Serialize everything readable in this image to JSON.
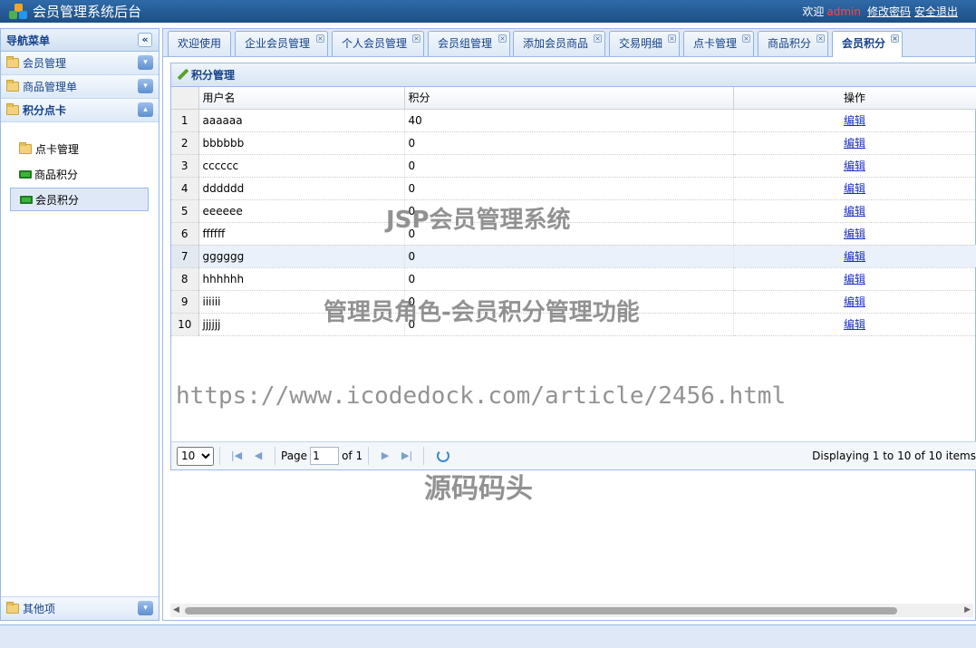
{
  "app": {
    "title": "会员管理系统后台"
  },
  "topright": {
    "welcome": "欢迎",
    "user": "admin",
    "change_password": "修改密码",
    "logout": "安全退出"
  },
  "nav": {
    "header": "导航菜单",
    "collapse_glyph": "«",
    "sections": [
      {
        "label": "会员管理",
        "toggle": "▾"
      },
      {
        "label": "商品管理单",
        "toggle": "▾"
      },
      {
        "label": "积分点卡",
        "toggle": "▴"
      }
    ],
    "subitems": [
      {
        "label": "点卡管理"
      },
      {
        "label": "商品积分"
      },
      {
        "label": "会员积分"
      }
    ],
    "bottom_section": {
      "label": "其他项",
      "toggle": "▾"
    }
  },
  "tabs": [
    {
      "label": "欢迎使用"
    },
    {
      "label": "企业会员管理"
    },
    {
      "label": "个人会员管理"
    },
    {
      "label": "会员组管理"
    },
    {
      "label": "添加会员商品"
    },
    {
      "label": "交易明细"
    },
    {
      "label": "点卡管理"
    },
    {
      "label": "商品积分"
    },
    {
      "label": "会员积分"
    }
  ],
  "panel": {
    "title": "积分管理",
    "columns": {
      "username": "用户名",
      "points": "积分",
      "action": "操作"
    },
    "rows": [
      {
        "n": "1",
        "username": "aaaaaa",
        "points": "40",
        "action": "编辑"
      },
      {
        "n": "2",
        "username": "bbbbbb",
        "points": "0",
        "action": "编辑"
      },
      {
        "n": "3",
        "username": "cccccc",
        "points": "0",
        "action": "编辑"
      },
      {
        "n": "4",
        "username": "dddddd",
        "points": "0",
        "action": "编辑"
      },
      {
        "n": "5",
        "username": "eeeeee",
        "points": "0",
        "action": "编辑"
      },
      {
        "n": "6",
        "username": "ffffff",
        "points": "0",
        "action": "编辑"
      },
      {
        "n": "7",
        "username": "gggggg",
        "points": "0",
        "action": "编辑"
      },
      {
        "n": "8",
        "username": "hhhhhh",
        "points": "0",
        "action": "编辑"
      },
      {
        "n": "9",
        "username": "iiiiii",
        "points": "0",
        "action": "编辑"
      },
      {
        "n": "10",
        "username": "jjjjjj",
        "points": "0",
        "action": "编辑"
      }
    ]
  },
  "pager": {
    "page_size": "10",
    "page_label": "Page",
    "current_page": "1",
    "of_label": "of 1",
    "first_glyph": "|◀",
    "prev_glyph": "◀",
    "next_glyph": "▶",
    "last_glyph": "▶|",
    "info": "Displaying 1 to 10 of 10 items"
  },
  "scroll": {
    "left_glyph": "◀",
    "right_glyph": "▶"
  },
  "watermarks": {
    "w1": "JSP会员管理系统",
    "w2": "管理员角色-会员积分管理功能",
    "w3": "https://www.icodedock.com/article/2456.html",
    "w4": "源码码头"
  }
}
